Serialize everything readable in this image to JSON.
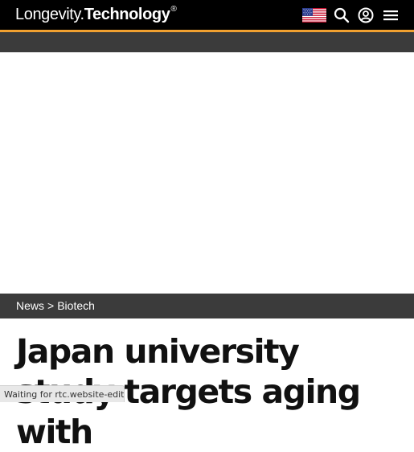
{
  "header": {
    "logo_light": "Longevity.",
    "logo_bold": "Technology",
    "logo_mark": "®",
    "region_flag_icon": "us-flag-icon",
    "search_icon": "search-icon",
    "account_icon": "account-icon",
    "menu_icon": "hamburger-menu-icon",
    "accent_color": "#f0a030"
  },
  "breadcrumb": {
    "items": [
      "News",
      "Biotech"
    ],
    "separator": ">"
  },
  "article": {
    "title": "Japan university study targets aging with"
  },
  "status_bar": {
    "text": "Waiting for rtc.website-edit..."
  }
}
